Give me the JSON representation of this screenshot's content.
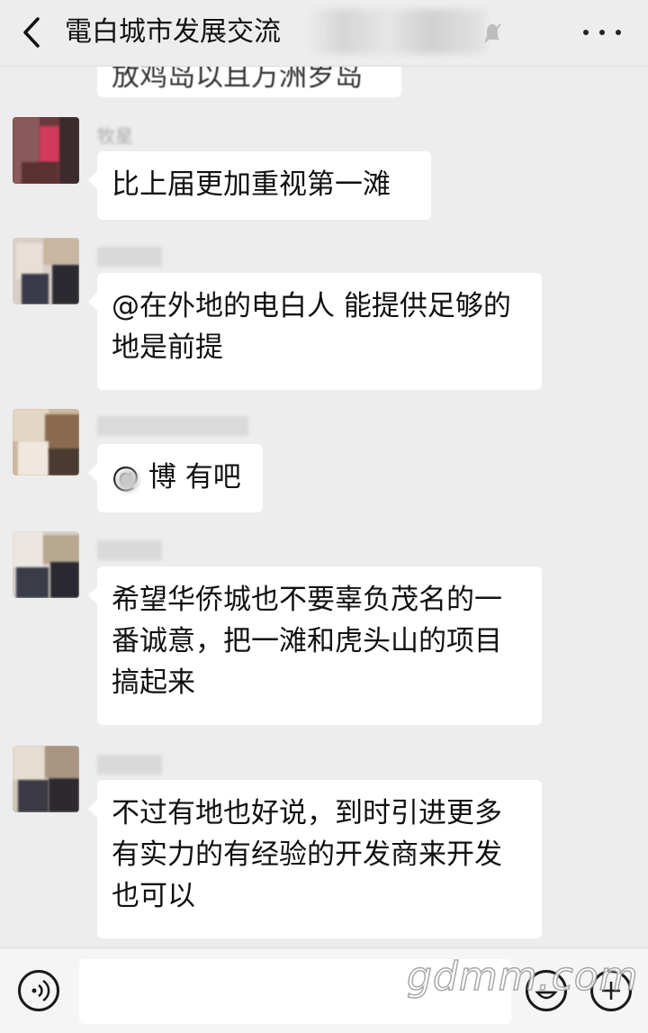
{
  "header": {
    "title": "電白城市发展交流",
    "back_icon": "chevron-left-icon",
    "mute_icon": "bell-off-icon",
    "more_icon": "more-dots-icon"
  },
  "messages": [
    {
      "text": "放鸡岛以且万洲岁岛",
      "partial": true
    },
    {
      "sender": "牧星",
      "text": "比上届更加重视第一滩"
    },
    {
      "sender": "",
      "text": "@在外地的电白人  能提供足够的地是前提"
    },
    {
      "sender": "",
      "text": "@ 博  有吧"
    },
    {
      "sender": "",
      "text": "希望华侨城也不要辜负茂名的一番诚意，把一滩和虎头山的项目搞起来"
    },
    {
      "sender": "",
      "text": "不过有地也好说，到时引进更多有实力的有经验的开发商来开发也可以"
    }
  ],
  "input_bar": {
    "voice_icon": "voice-icon",
    "input_value": "",
    "emoji_icon": "emoji-icon",
    "plus_icon": "plus-icon"
  },
  "watermark": "gdmm.com",
  "colors": {
    "background": "#ededed",
    "bubble": "#ffffff",
    "text": "#111111"
  }
}
